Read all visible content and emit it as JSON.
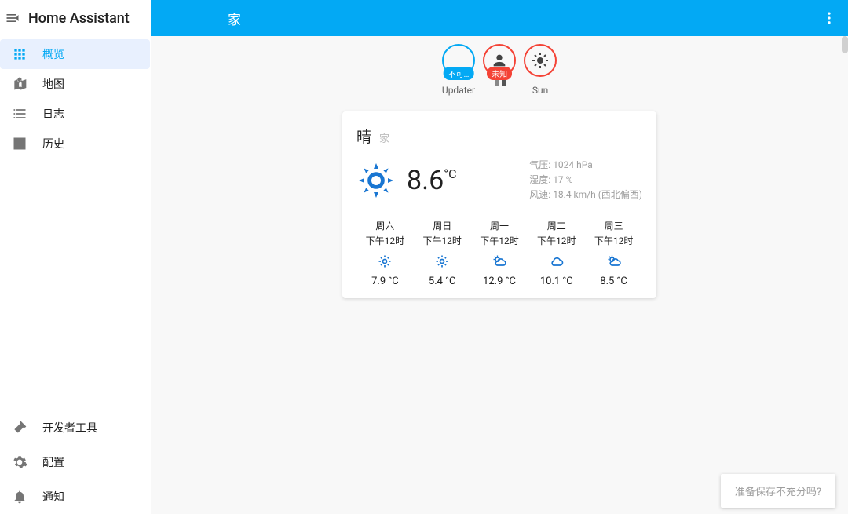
{
  "app": {
    "title": "Home Assistant"
  },
  "topbar": {
    "title": "家"
  },
  "sidebar": {
    "items": [
      {
        "label": "概览",
        "icon": "grid-icon",
        "active": true
      },
      {
        "label": "地图",
        "icon": "map-icon"
      },
      {
        "label": "日志",
        "icon": "list-icon"
      },
      {
        "label": "历史",
        "icon": "chart-icon"
      }
    ],
    "bottom": [
      {
        "label": "开发者工具",
        "icon": "hammer-icon"
      },
      {
        "label": "配置",
        "icon": "gear-icon"
      },
      {
        "label": "通知",
        "icon": "bell-icon"
      }
    ]
  },
  "badges": [
    {
      "name": "updater",
      "label": "Updater",
      "pill": "不可…",
      "color": "blue",
      "icon": ""
    },
    {
      "name": "person",
      "label": "",
      "pill": "未知",
      "color": "red",
      "icon": "person-icon",
      "sub_boxes": true
    },
    {
      "name": "sun",
      "label": "Sun",
      "pill": "",
      "color": "red",
      "icon": "sun-icon"
    }
  ],
  "weather": {
    "state": "晴",
    "location": "家",
    "temp": "8.6",
    "unit": "°C",
    "attrs": {
      "pressure_label": "气压:",
      "pressure": "1024 hPa",
      "humidity_label": "湿度:",
      "humidity": "17 %",
      "wind_label": "风速:",
      "wind": "18.4 km/h (西北偏西)"
    },
    "forecast": [
      {
        "day": "周六",
        "time": "下午12时",
        "icon": "sunny",
        "temp": "7.9 °C"
      },
      {
        "day": "周日",
        "time": "下午12时",
        "icon": "sunny",
        "temp": "5.4 °C"
      },
      {
        "day": "周一",
        "time": "下午12时",
        "icon": "partly",
        "temp": "12.9 °C"
      },
      {
        "day": "周二",
        "time": "下午12时",
        "icon": "cloudy",
        "temp": "10.1 °C"
      },
      {
        "day": "周三",
        "time": "下午12时",
        "icon": "partly",
        "temp": "8.5 °C"
      }
    ]
  },
  "notification": {
    "text": "准备保存不充分吗?"
  }
}
